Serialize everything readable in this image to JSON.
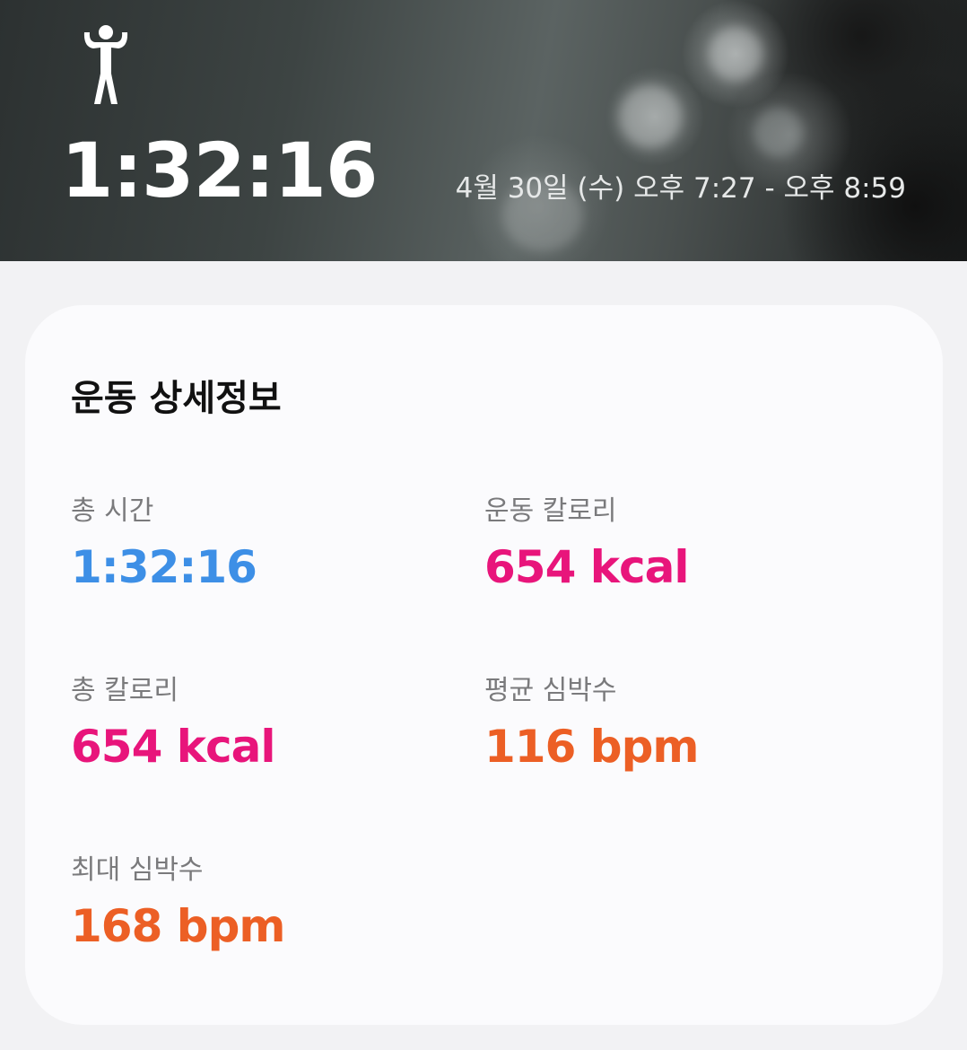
{
  "header": {
    "activity_icon": "workout-person-icon",
    "duration": "1:32:16",
    "time_range": "4월 30일 (수) 오후 7:27 - 오후 8:59"
  },
  "details": {
    "title": "운동 상세정보",
    "stats": [
      {
        "label": "총 시간",
        "value": "1:32:16",
        "color": "#3d8fe6"
      },
      {
        "label": "운동 칼로리",
        "value": "654 kcal",
        "color": "#e8157b"
      },
      {
        "label": "총 칼로리",
        "value": "654 kcal",
        "color": "#e8157b"
      },
      {
        "label": "평균 심박수",
        "value": "116 bpm",
        "color": "#ec5f25"
      },
      {
        "label": "최대 심박수",
        "value": "168 bpm",
        "color": "#ec5f25"
      }
    ]
  }
}
